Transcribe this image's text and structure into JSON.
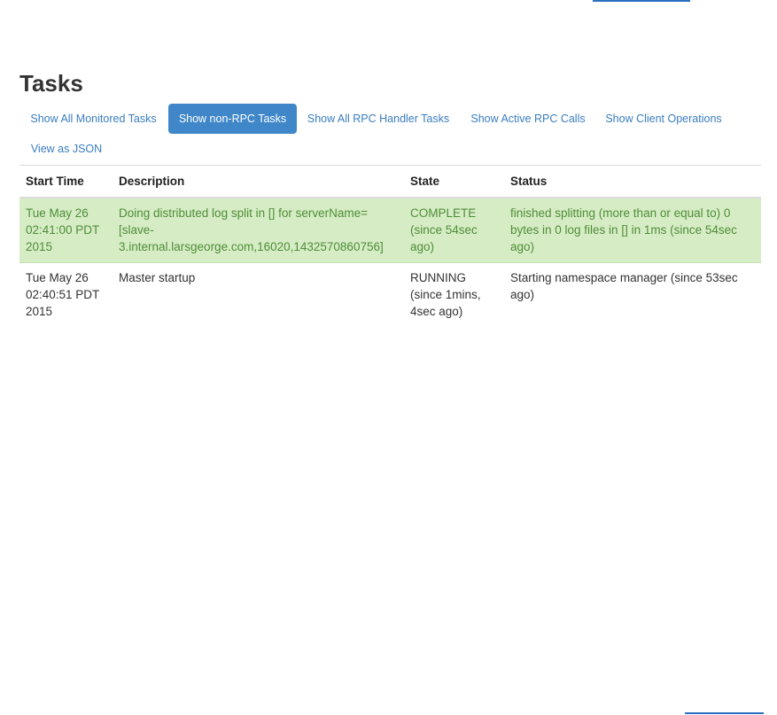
{
  "header": {
    "title": "Tasks"
  },
  "nav": {
    "pills": [
      {
        "label": "Show All Monitored Tasks"
      },
      {
        "label": "Show non-RPC Tasks"
      },
      {
        "label": "Show All RPC Handler Tasks"
      },
      {
        "label": "Show Active RPC Calls"
      },
      {
        "label": "Show Client Operations"
      },
      {
        "label": "View as JSON"
      }
    ],
    "active_index": 1
  },
  "table": {
    "columns": [
      "Start Time",
      "Description",
      "State",
      "Status"
    ],
    "rows": [
      {
        "start_time": "Tue May 26 02:41:00 PDT 2015",
        "description": "Doing distributed log split in [] for serverName=[slave-3.internal.larsgeorge.com,16020,1432570860756]",
        "state": "COMPLETE (since 54sec ago)",
        "status": "finished splitting (more than or equal to) 0 bytes in 0 log files in [] in 1ms (since 54sec ago)",
        "row_style": "success"
      },
      {
        "start_time": "Tue May 26 02:40:51 PDT 2015",
        "description": "Master startup",
        "state": "RUNNING (since 1mins, 4sec ago)",
        "status": "Starting namespace manager (since 53sec ago)",
        "row_style": "default"
      }
    ]
  },
  "colors": {
    "link": "#3a7dc0",
    "active_pill_bg": "#3f87c8",
    "success_row_bg": "#d6ecc4",
    "success_row_text": "#4f8d3a"
  }
}
